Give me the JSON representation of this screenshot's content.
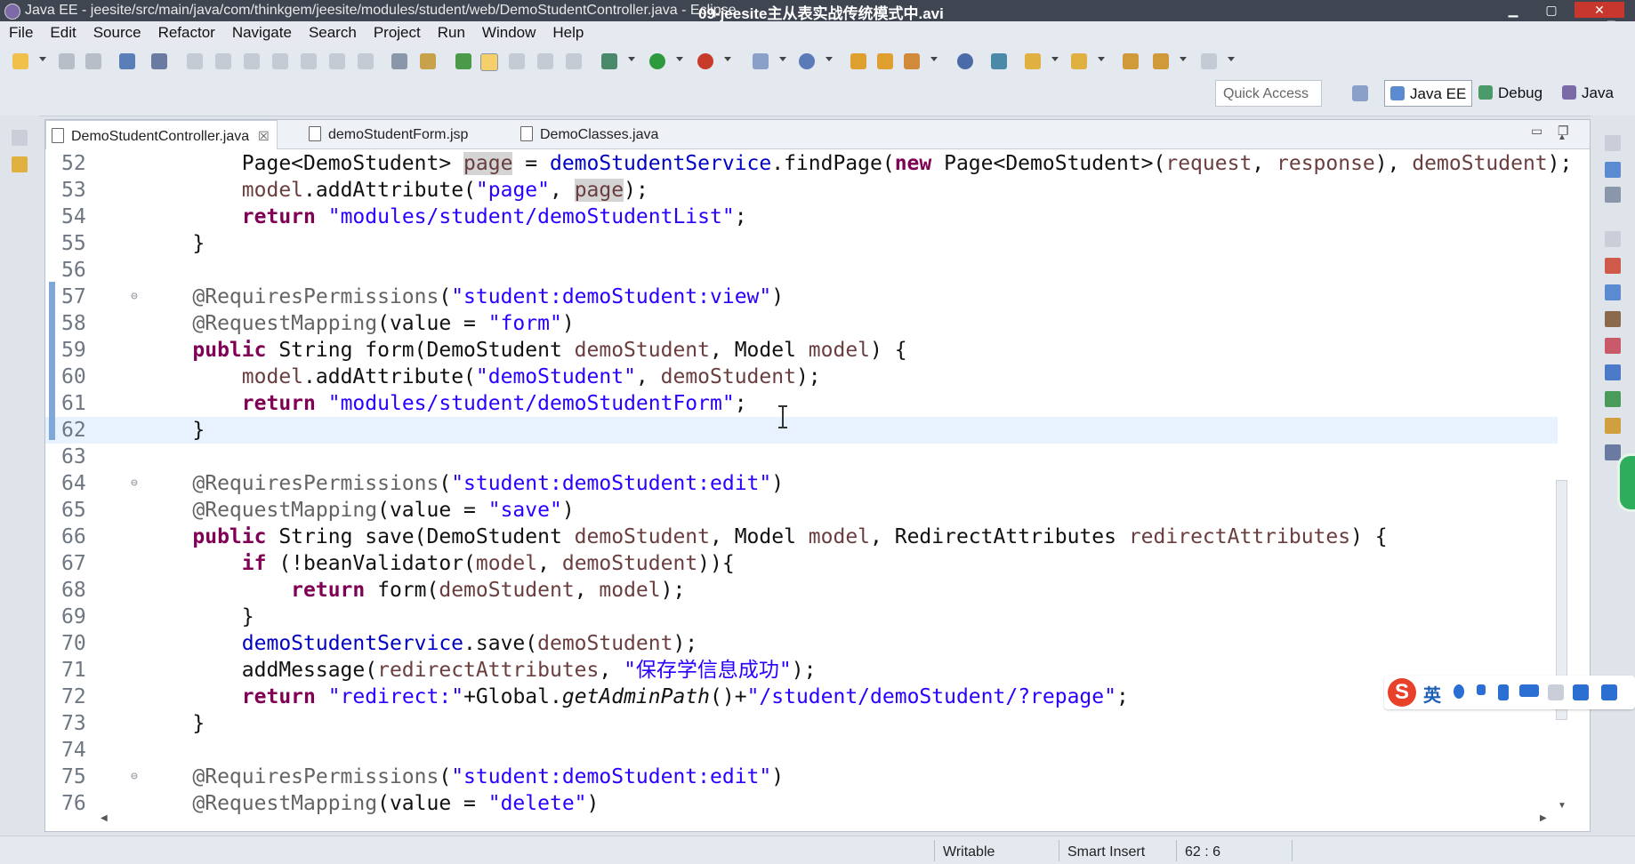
{
  "window": {
    "title": "Java EE - jeesite/src/main/java/com/thinkgem/jeesite/modules/student/web/DemoStudentController.java - Eclipse",
    "video_title": "09-jeesite主从表实战传统模式中.avi"
  },
  "menu": [
    "File",
    "Edit",
    "Source",
    "Refactor",
    "Navigate",
    "Search",
    "Project",
    "Run",
    "Window",
    "Help"
  ],
  "toolbar": {
    "quick_access_placeholder": "Quick Access",
    "perspectives": [
      {
        "label": "Java EE",
        "active": true
      },
      {
        "label": "Debug",
        "active": false
      },
      {
        "label": "Java",
        "active": false
      }
    ]
  },
  "tabs": [
    {
      "label": "DemoStudentController.java",
      "active": true,
      "close": "☒"
    },
    {
      "label": "demoStudentForm.jsp",
      "active": false
    },
    {
      "label": "DemoClasses.java",
      "active": false
    }
  ],
  "code_lines": [
    {
      "n": "52",
      "html": "    Page&lt;DemoStudent&gt; <span class='occ var'>page</span> = <span class='fld'>demoStudentService</span>.findPage(<span class='kw'>new</span> Page&lt;DemoStudent&gt;(<span class='var'>request</span>, <span class='var'>response</span>), <span class='var'>demoStudent</span>);"
    },
    {
      "n": "53",
      "html": "    <span class='var'>model</span>.addAttribute(<span class='str'>\"page\"</span>, <span class='occ var'>page</span>);"
    },
    {
      "n": "54",
      "html": "    <span class='kw'>return</span> <span class='str'>\"modules/student/demoStudentList\"</span>;"
    },
    {
      "n": "55",
      "html": "}"
    },
    {
      "n": "56",
      "html": ""
    },
    {
      "n": "57",
      "fold": true,
      "html": "<span class='ann'>@RequiresPermissions</span>(<span class='str'>\"student:demoStudent:view\"</span>)"
    },
    {
      "n": "58",
      "html": "<span class='ann'>@RequestMapping</span>(value = <span class='str'>\"form\"</span>)"
    },
    {
      "n": "59",
      "html": "<span class='kw'>public</span> String form(DemoStudent <span class='var'>demoStudent</span>, Model <span class='var'>model</span>) {"
    },
    {
      "n": "60",
      "html": "    <span class='var'>model</span>.addAttribute(<span class='str'>\"demoStudent\"</span>, <span class='var'>demoStudent</span>);"
    },
    {
      "n": "61",
      "html": "    <span class='kw'>return</span> <span class='str'>\"modules/student/demoStudentForm\"</span>;"
    },
    {
      "n": "62",
      "cur": true,
      "html": "}"
    },
    {
      "n": "63",
      "html": ""
    },
    {
      "n": "64",
      "fold": true,
      "html": "<span class='ann'>@RequiresPermissions</span>(<span class='str'>\"student:demoStudent:edit\"</span>)"
    },
    {
      "n": "65",
      "html": "<span class='ann'>@RequestMapping</span>(value = <span class='str'>\"save\"</span>)"
    },
    {
      "n": "66",
      "html": "<span class='kw'>public</span> String save(DemoStudent <span class='var'>demoStudent</span>, Model <span class='var'>model</span>, RedirectAttributes <span class='var'>redirectAttributes</span>) {"
    },
    {
      "n": "67",
      "html": "    <span class='kw'>if</span> (!beanValidator(<span class='var'>model</span>, <span class='var'>demoStudent</span>)){"
    },
    {
      "n": "68",
      "html": "        <span class='kw'>return</span> form(<span class='var'>demoStudent</span>, <span class='var'>model</span>);"
    },
    {
      "n": "69",
      "html": "    }"
    },
    {
      "n": "70",
      "html": "    <span class='fld'>demoStudentService</span>.save(<span class='var'>demoStudent</span>);"
    },
    {
      "n": "71",
      "html": "    addMessage(<span class='var'>redirectAttributes</span>, <span class='str'>\"保存学信息成功\"</span>);"
    },
    {
      "n": "72",
      "html": "    <span class='kw'>return</span> <span class='str'>\"redirect:\"</span>+Global.<span class='it'>getAdminPath</span>()+<span class='str'>\"/student/demoStudent/?repage\"</span>;"
    },
    {
      "n": "73",
      "html": "}"
    },
    {
      "n": "74",
      "html": ""
    },
    {
      "n": "75",
      "fold": true,
      "html": "<span class='ann'>@RequiresPermissions</span>(<span class='str'>\"student:demoStudent:edit\"</span>)"
    },
    {
      "n": "76",
      "html": "<span class='ann'>@RequestMapping</span>(value = <span class='str'>\"delete\"</span>)"
    }
  ],
  "status": {
    "writable": "Writable",
    "insert_mode": "Smart Insert",
    "position": "62 : 6"
  },
  "ime": {
    "lang": "英",
    "logo": "S"
  },
  "colors": {
    "keyword": "#7f0055",
    "string": "#2a00ff",
    "annotation": "#646464",
    "field": "#0000c0",
    "variable": "#6a3e3e",
    "current_line": "#e8f2fe"
  }
}
